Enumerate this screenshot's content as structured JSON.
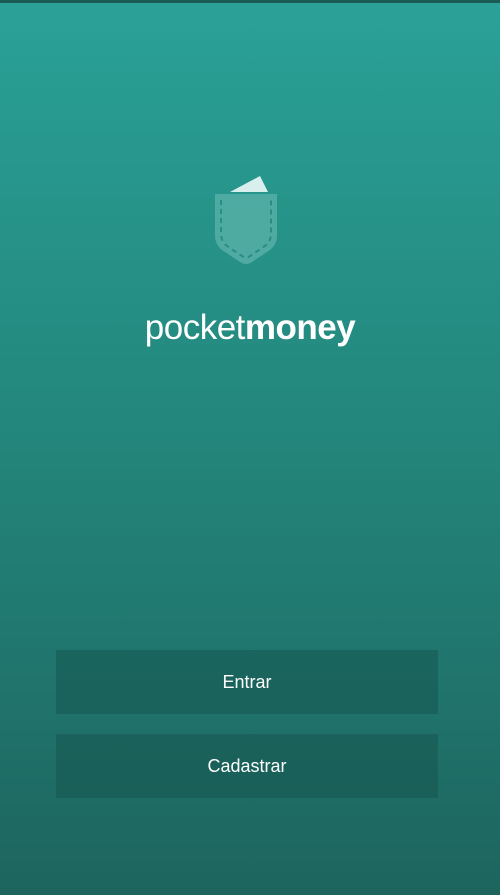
{
  "brand": {
    "name_light": "pocket",
    "name_bold": "money"
  },
  "actions": {
    "login_label": "Entrar",
    "signup_label": "Cadastrar"
  },
  "icons": {
    "logo": "pocket-wallet-icon"
  },
  "colors": {
    "background_top": "#2aa197",
    "background_bottom": "#1d655e",
    "button_bg": "#1d5f59",
    "text": "#ffffff"
  }
}
